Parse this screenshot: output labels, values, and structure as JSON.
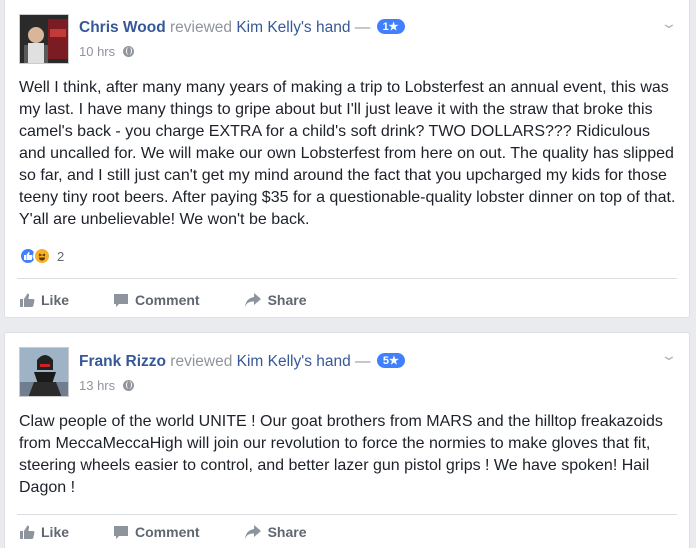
{
  "reviews": [
    {
      "author": "Chris Wood",
      "verb": "reviewed",
      "page": "Kim Kelly's hand",
      "dash": "—",
      "rating": "1★",
      "time": "10 hrs",
      "text": "Well I think, after many many years of making a trip to Lobsterfest an annual event, this was my last. I have many things to gripe about but I'll just leave it with the straw that broke this camel's back - you charge EXTRA for a child's soft drink? TWO DOLLARS??? Ridiculous and uncalled for. We will make our own Lobsterfest from here on out. The quality has slipped so far, and I still just can't get my mind around the fact that you upcharged my kids for those teeny tiny root beers. After paying $35 for a questionable-quality lobster dinner on top of that. Y'all are unbelievable! We won't be back.",
      "reaction_count": "2",
      "actions": {
        "like": "Like",
        "comment": "Comment",
        "share": "Share"
      }
    },
    {
      "author": "Frank Rizzo",
      "verb": "reviewed",
      "page": "Kim Kelly's hand",
      "dash": "—",
      "rating": "5★",
      "time": "13 hrs",
      "text": "Claw people of the world UNITE ! Our goat brothers from MARS and the hilltop freakazoids from MeccaMeccaHigh will join our revolution to force the normies to make gloves that fit, steering wheels easier to control, and better lazer gun pistol grips ! We have spoken! Hail Dagon !",
      "actions": {
        "like": "Like",
        "comment": "Comment",
        "share": "Share"
      }
    }
  ],
  "icons": [
    "chevron-down-icon",
    "globe-icon",
    "like-icon",
    "comment-icon",
    "share-icon",
    "like-reaction-icon",
    "haha-reaction-icon"
  ],
  "colors": {
    "link": "#365899",
    "meta": "#90949c",
    "rating_badge": "#4080ff",
    "background": "#e9ebee"
  }
}
